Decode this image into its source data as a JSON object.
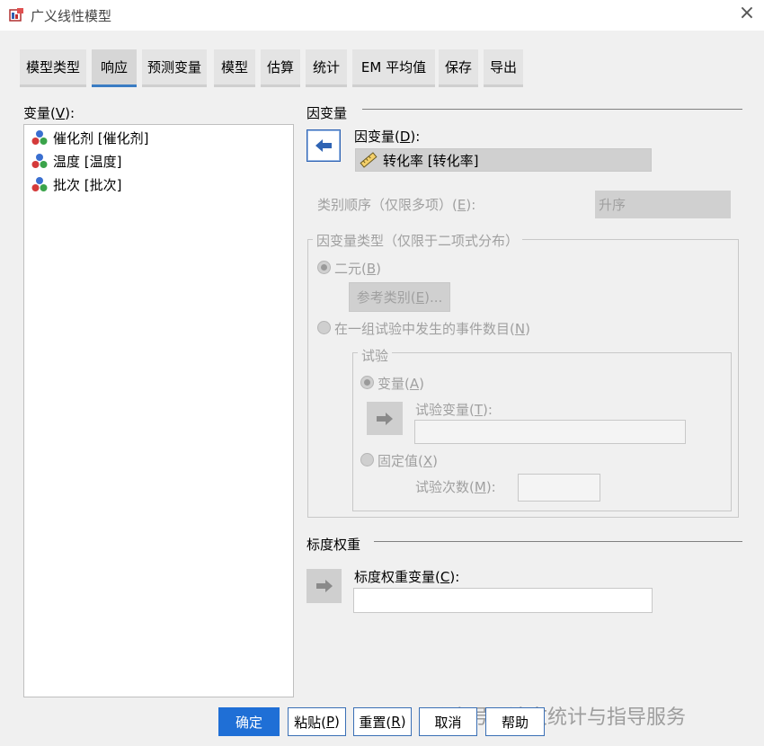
{
  "window": {
    "title": "广义线性模型",
    "close_icon": "close-icon"
  },
  "tabs": [
    {
      "label": "模型类型"
    },
    {
      "label": "响应",
      "active": true
    },
    {
      "label": "预测变量"
    },
    {
      "label": "模型"
    },
    {
      "label": "估算"
    },
    {
      "label": "统计"
    },
    {
      "label": "EM 平均值"
    },
    {
      "label": "保存"
    },
    {
      "label": "导出"
    }
  ],
  "variables": {
    "label_prefix": "变量(",
    "label_key": "V",
    "label_suffix": "):",
    "items": [
      {
        "label": "催化剂 [催化剂]",
        "icon": "nominal-icon"
      },
      {
        "label": "温度 [温度]",
        "icon": "nominal-icon"
      },
      {
        "label": "批次 [批次]",
        "icon": "nominal-icon"
      }
    ]
  },
  "dependent": {
    "section_title": "因变量",
    "field_label_prefix": "因变量(",
    "field_label_key": "D",
    "field_label_suffix": "):",
    "value": "转化率 [转化率]",
    "value_icon": "scale-icon",
    "category_order_label_prefix": "类别顺序（仅限多项）(",
    "category_order_label_key": "E",
    "category_order_label_suffix": "):",
    "category_order_value": "升序"
  },
  "dep_type": {
    "legend": "因变量类型（仅限于二项式分布）",
    "binary_prefix": "二元(",
    "binary_key": "B",
    "binary_suffix": ")",
    "reference_button_prefix": "参考类别(",
    "reference_button_key": "E",
    "reference_button_suffix": ")...",
    "events_prefix": "在一组试验中发生的事件数目(",
    "events_key": "N",
    "events_suffix": ")"
  },
  "trials": {
    "legend": "试验",
    "variable_prefix": "变量(",
    "variable_key": "A",
    "variable_suffix": ")",
    "trial_var_prefix": "试验变量(",
    "trial_var_key": "T",
    "trial_var_suffix": "):",
    "fixed_prefix": "固定值(",
    "fixed_key": "X",
    "fixed_suffix": ")",
    "count_prefix": "试验次数(",
    "count_key": "M",
    "count_suffix": "):"
  },
  "scale_weight": {
    "section_title": "标度权重",
    "field_label_prefix": "标度权重变量(",
    "field_label_key": "C",
    "field_label_suffix": "):"
  },
  "buttons": {
    "ok": "确定",
    "paste_prefix": "粘贴(",
    "paste_key": "P",
    "paste_suffix": ")",
    "reset_prefix": "重置(",
    "reset_key": "R",
    "reset_suffix": ")",
    "cancel": "取消",
    "help": "帮助"
  },
  "watermark": "公众号 · 论文统计与指导服务",
  "colors": {
    "accent": "#1f6fd6",
    "tab_active_underline": "#3a7cc3"
  }
}
